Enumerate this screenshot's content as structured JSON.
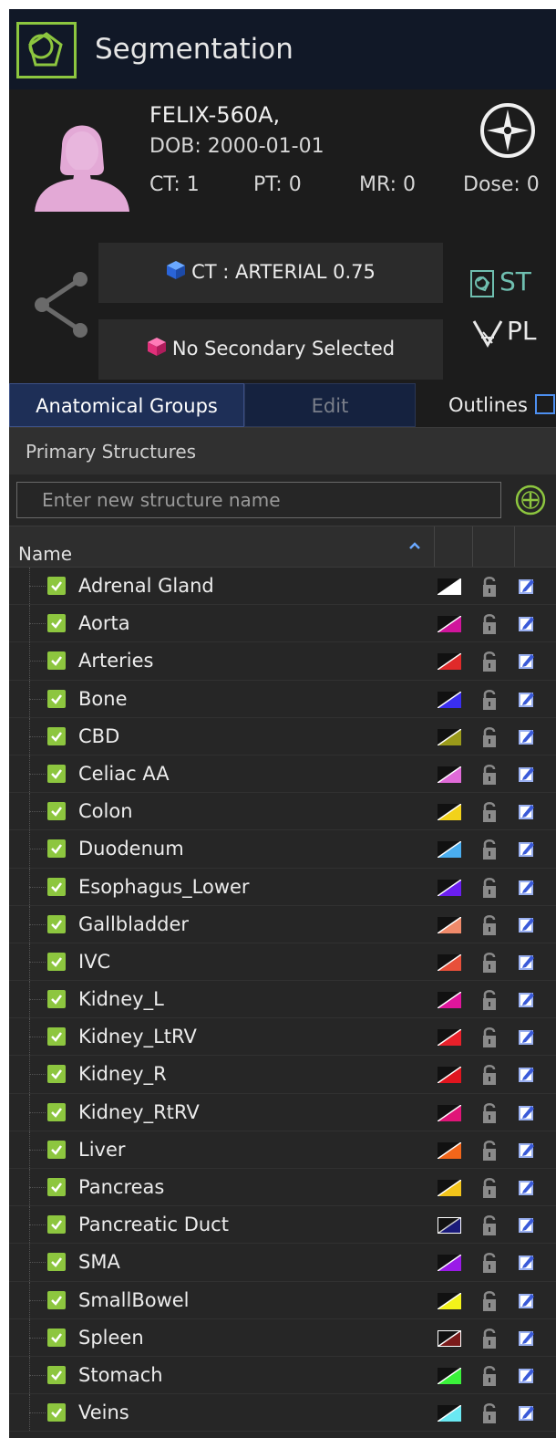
{
  "header": {
    "title": "Segmentation"
  },
  "patient": {
    "name": "FELIX-560A,",
    "dob": "DOB: 2000-01-01",
    "counts": {
      "ct": "CT: 1",
      "pt": "PT: 0",
      "mr": "MR: 0",
      "dose": "Dose: 0"
    }
  },
  "series": {
    "primary": "CT : ARTERIAL  0.75",
    "secondary": "No Secondary Selected"
  },
  "tools": {
    "st_label": "ST",
    "pl_label": "PL"
  },
  "tabs": {
    "anatomical_groups": "Anatomical Groups",
    "edit": "Edit",
    "outlines": "Outlines"
  },
  "structures": {
    "section_title": "Primary Structures",
    "input_placeholder": "Enter new structure name",
    "column_name": "Name",
    "items": [
      {
        "name": "Adrenal Gland",
        "color": "#ffffff"
      },
      {
        "name": "Aorta",
        "color": "#d0159c"
      },
      {
        "name": "Arteries",
        "color": "#e02a2a"
      },
      {
        "name": "Bone",
        "color": "#3a2ef0"
      },
      {
        "name": "CBD",
        "color": "#9a9a1a"
      },
      {
        "name": "Celiac AA",
        "color": "#e06ad8"
      },
      {
        "name": "Colon",
        "color": "#f2d21a"
      },
      {
        "name": "Duodenum",
        "color": "#4aaef0"
      },
      {
        "name": "Esophagus_Lower",
        "color": "#6a1ef0"
      },
      {
        "name": "Gallbladder",
        "color": "#f08a6a"
      },
      {
        "name": "IVC",
        "color": "#e8503a"
      },
      {
        "name": "Kidney_L",
        "color": "#e0159c"
      },
      {
        "name": "Kidney_LtRV",
        "color": "#e8202a"
      },
      {
        "name": "Kidney_R",
        "color": "#e0151e"
      },
      {
        "name": "Kidney_RtRV",
        "color": "#e01578"
      },
      {
        "name": "Liver",
        "color": "#f2661a"
      },
      {
        "name": "Pancreas",
        "color": "#f2c41a"
      },
      {
        "name": "Pancreatic Duct",
        "color": "#1a1a7a"
      },
      {
        "name": "SMA",
        "color": "#9a1ae8"
      },
      {
        "name": "SmallBowel",
        "color": "#f2f21a"
      },
      {
        "name": "Spleen",
        "color": "#7a1a1a"
      },
      {
        "name": "Stomach",
        "color": "#3af23a"
      },
      {
        "name": "Veins",
        "color": "#6ae8f2"
      }
    ]
  },
  "colors": {
    "accent": "#8dc63f",
    "tab_active": "#1e2f57",
    "st_teal": "#6fbfb0",
    "avatar": "#e3a9d6"
  }
}
